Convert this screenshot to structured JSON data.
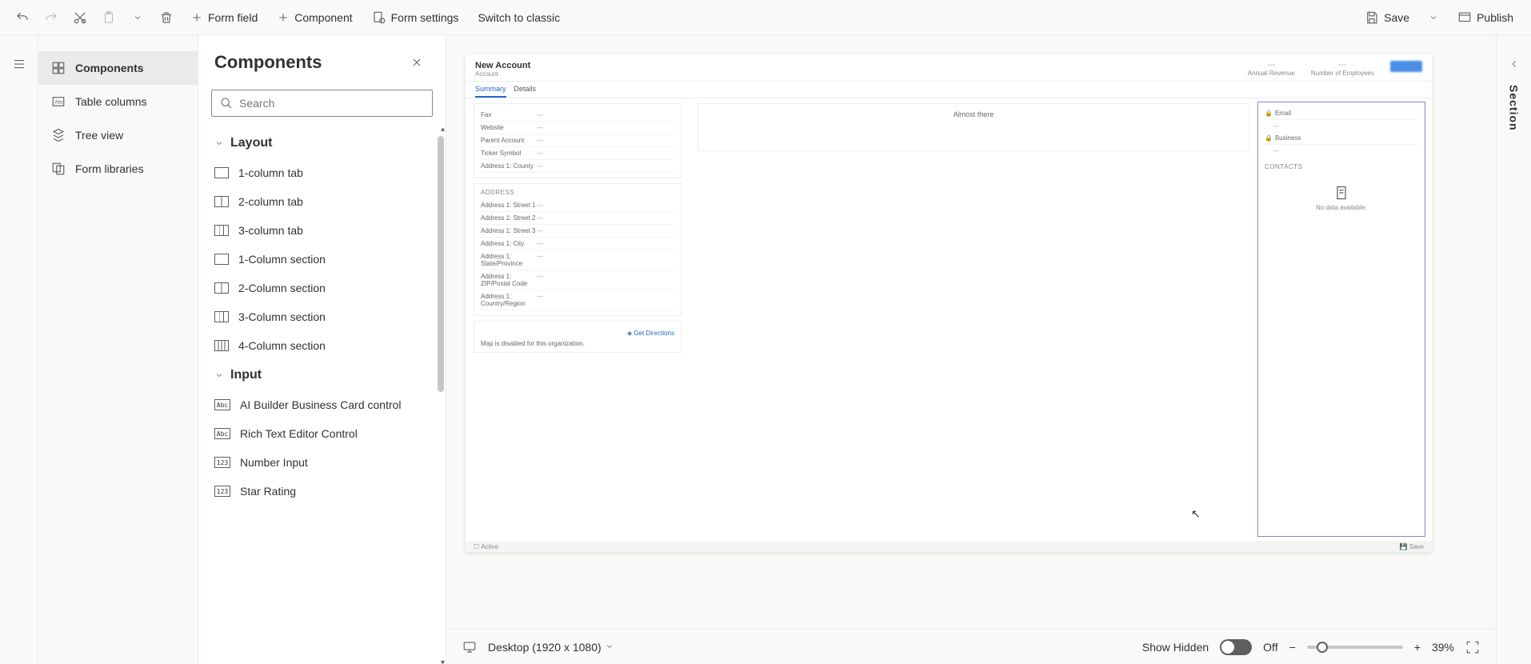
{
  "toolbar": {
    "form_field": "Form field",
    "component": "Component",
    "form_settings": "Form settings",
    "switch_classic": "Switch to classic",
    "save": "Save",
    "publish": "Publish"
  },
  "left_rail": {
    "components": "Components",
    "table_columns": "Table columns",
    "tree_view": "Tree view",
    "form_libraries": "Form libraries"
  },
  "components_panel": {
    "title": "Components",
    "search_placeholder": "Search",
    "groups": {
      "layout": {
        "title": "Layout",
        "items": [
          "1-column tab",
          "2-column tab",
          "3-column tab",
          "1-Column section",
          "2-Column section",
          "3-Column section",
          "4-Column section"
        ]
      },
      "input": {
        "title": "Input",
        "items": [
          "AI Builder Business Card control",
          "Rich Text Editor Control",
          "Number Input",
          "Star Rating"
        ]
      }
    }
  },
  "form_preview": {
    "title": "New Account",
    "subtitle": "Account",
    "header_fields": [
      {
        "label": "Annual Revenue",
        "value": "---"
      },
      {
        "label": "Number of Employees",
        "value": "---"
      }
    ],
    "tabs": [
      {
        "label": "Summary",
        "active": true
      },
      {
        "label": "Details",
        "active": false
      }
    ],
    "left_fields_top": [
      {
        "label": "Fax",
        "value": "---"
      },
      {
        "label": "Website",
        "value": "---"
      },
      {
        "label": "Parent Account",
        "value": "---"
      },
      {
        "label": "Ticker Symbol",
        "value": "---"
      },
      {
        "label": "Address 1: County",
        "value": "---"
      }
    ],
    "address_title": "ADDRESS",
    "address_fields": [
      {
        "label": "Address 1: Street 1",
        "value": "---"
      },
      {
        "label": "Address 1: Street 2",
        "value": "---"
      },
      {
        "label": "Address 1: Street 3",
        "value": "---"
      },
      {
        "label": "Address 1: City",
        "value": "---"
      },
      {
        "label": "Address 1: State/Province",
        "value": "---"
      },
      {
        "label": "Address 1: ZIP/Postal Code",
        "value": "---"
      },
      {
        "label": "Address 1: Country/Region",
        "value": "---"
      }
    ],
    "get_directions": "Get Directions",
    "map_disabled": "Map is disabled for this organization.",
    "timeline": "Almost there",
    "right_fields": [
      {
        "label": "Email",
        "value": "---"
      },
      {
        "label": "Business",
        "value": "---"
      }
    ],
    "contacts_title": "CONTACTS",
    "contacts_empty": "No data available.",
    "footer_status": "Active",
    "footer_save": "Save"
  },
  "bottom_bar": {
    "viewport": "Desktop (1920 x 1080)",
    "show_hidden": "Show Hidden",
    "toggle_state": "Off",
    "zoom": "39%"
  },
  "right_panel": {
    "label": "Section"
  }
}
